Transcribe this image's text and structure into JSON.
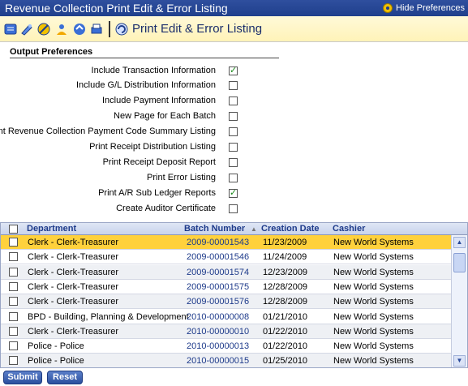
{
  "window": {
    "title": "Revenue Collection Print Edit & Error Listing",
    "hide_preferences": "Hide Preferences"
  },
  "toolbar": {
    "title": "Print Edit & Error Listing",
    "icons": [
      "list-icon",
      "pencil-icon",
      "no-entry-icon",
      "users-icon",
      "arrows-icon",
      "print-icon",
      "refresh-icon"
    ]
  },
  "preferences": {
    "section_title": "Output Preferences",
    "items": [
      {
        "label": "Include Transaction Information",
        "checked": true
      },
      {
        "label": "Include G/L Distribution Information",
        "checked": false
      },
      {
        "label": "Include Payment Information",
        "checked": false
      },
      {
        "label": "New Page for Each Batch",
        "checked": false
      },
      {
        "label": "Print Revenue Collection Payment Code Summary Listing",
        "checked": false
      },
      {
        "label": "Print Receipt Distribution Listing",
        "checked": false
      },
      {
        "label": "Print Receipt Deposit Report",
        "checked": false
      },
      {
        "label": "Print Error Listing",
        "checked": false
      },
      {
        "label": "Print A/R Sub Ledger Reports",
        "checked": true
      },
      {
        "label": "Create Auditor Certificate",
        "checked": false
      }
    ]
  },
  "grid": {
    "columns": [
      "Department",
      "Batch Number",
      "Creation Date",
      "Cashier"
    ],
    "rows": [
      {
        "department": "Clerk - Clerk-Treasurer",
        "batch": "2009-00001543",
        "date": "11/23/2009",
        "cashier": "New World Systems"
      },
      {
        "department": "Clerk - Clerk-Treasurer",
        "batch": "2009-00001546",
        "date": "11/24/2009",
        "cashier": "New World Systems"
      },
      {
        "department": "Clerk - Clerk-Treasurer",
        "batch": "2009-00001574",
        "date": "12/23/2009",
        "cashier": "New World Systems"
      },
      {
        "department": "Clerk - Clerk-Treasurer",
        "batch": "2009-00001575",
        "date": "12/28/2009",
        "cashier": "New World Systems"
      },
      {
        "department": "Clerk - Clerk-Treasurer",
        "batch": "2009-00001576",
        "date": "12/28/2009",
        "cashier": "New World Systems"
      },
      {
        "department": "BPD - Building, Planning & Development",
        "batch": "2010-00000008",
        "date": "01/21/2010",
        "cashier": "New World Systems"
      },
      {
        "department": "Clerk - Clerk-Treasurer",
        "batch": "2010-00000010",
        "date": "01/22/2010",
        "cashier": "New World Systems"
      },
      {
        "department": "Police - Police",
        "batch": "2010-00000013",
        "date": "01/22/2010",
        "cashier": "New World Systems"
      },
      {
        "department": "Police - Police",
        "batch": "2010-00000015",
        "date": "01/25/2010",
        "cashier": "New World Systems"
      }
    ]
  },
  "buttons": {
    "submit": "Submit",
    "reset": "Reset"
  },
  "colors": {
    "titlebar": "#1f3f8c",
    "toolbar_bg": "#fff3b8",
    "selected_row": "#ffd13c",
    "header_text": "#1d3a8a"
  }
}
